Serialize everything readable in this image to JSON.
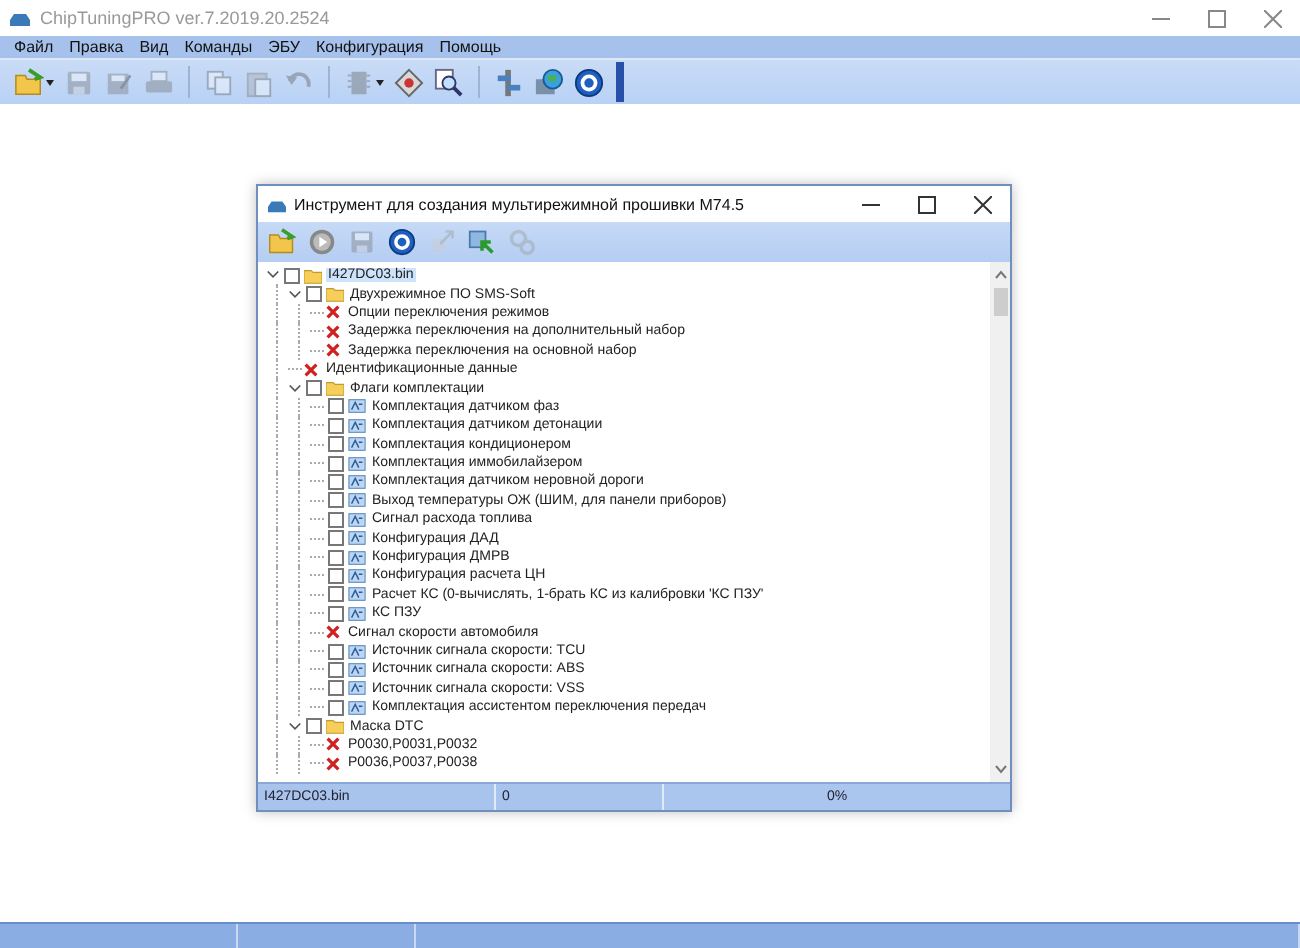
{
  "window": {
    "title": "ChipTuningPRO ver.7.2019.20.2524"
  },
  "menu": [
    "Файл",
    "Правка",
    "Вид",
    "Команды",
    "ЭБУ",
    "Конфигурация",
    "Помощь"
  ],
  "toolbar": [
    {
      "kind": "open",
      "disabled": false,
      "dropdown": true
    },
    {
      "kind": "save",
      "disabled": true,
      "dropdown": false
    },
    {
      "kind": "save-as",
      "disabled": true,
      "dropdown": false
    },
    {
      "kind": "print",
      "disabled": true,
      "dropdown": false
    },
    {
      "kind": "sep"
    },
    {
      "kind": "copy",
      "disabled": true,
      "dropdown": false
    },
    {
      "kind": "paste",
      "disabled": true,
      "dropdown": false
    },
    {
      "kind": "undo",
      "disabled": true,
      "dropdown": false
    },
    {
      "kind": "sep"
    },
    {
      "kind": "chip",
      "disabled": true,
      "dropdown": true
    },
    {
      "kind": "diamond",
      "disabled": false,
      "dropdown": false
    },
    {
      "kind": "zoom",
      "disabled": false,
      "dropdown": false
    },
    {
      "kind": "sep"
    },
    {
      "kind": "tools",
      "disabled": false,
      "dropdown": false
    },
    {
      "kind": "globe",
      "disabled": false,
      "dropdown": false
    },
    {
      "kind": "help",
      "disabled": false,
      "dropdown": false
    },
    {
      "kind": "overflow"
    }
  ],
  "dialog": {
    "title": "Инструмент для создания мультирежимной прошивки M74.5",
    "toolbar": [
      {
        "kind": "open",
        "disabled": false
      },
      {
        "kind": "play",
        "disabled": false
      },
      {
        "kind": "save",
        "disabled": true
      },
      {
        "kind": "help",
        "disabled": false
      },
      {
        "kind": "export",
        "disabled": true
      },
      {
        "kind": "import",
        "disabled": false
      },
      {
        "kind": "gears",
        "disabled": true
      }
    ],
    "tree": [
      {
        "kind": "folder",
        "label": "I427DC03.bin",
        "checked": false,
        "expanded": true,
        "selected": true,
        "children": [
          {
            "kind": "folder",
            "label": "Двухрежимное ПО SMS-Soft",
            "checked": false,
            "expanded": true,
            "selected": false,
            "children": [
              {
                "kind": "error",
                "label": "Опции переключения режимов",
                "selected": false
              },
              {
                "kind": "error",
                "label": "Задержка переключения на дополнительный набор",
                "selected": false
              },
              {
                "kind": "error",
                "label": "Задержка переключения на основной набор",
                "selected": false
              }
            ]
          },
          {
            "kind": "error",
            "label": "Идентификационные данные",
            "selected": false
          },
          {
            "kind": "folder",
            "label": "Флаги комплектации",
            "checked": false,
            "expanded": true,
            "selected": false,
            "children": [
              {
                "kind": "param",
                "label": "Комплектация датчиком фаз",
                "checked": false,
                "selected": false
              },
              {
                "kind": "param",
                "label": "Комплектация датчиком детонации",
                "checked": false,
                "selected": false
              },
              {
                "kind": "param",
                "label": "Комплектация кондиционером",
                "checked": false,
                "selected": false
              },
              {
                "kind": "param",
                "label": "Комплектация иммобилайзером",
                "checked": false,
                "selected": false
              },
              {
                "kind": "param",
                "label": "Комплектация датчиком неровной дороги",
                "checked": false,
                "selected": false
              },
              {
                "kind": "param",
                "label": "Выход температуры ОЖ (ШИМ, для панели приборов)",
                "checked": false,
                "selected": false
              },
              {
                "kind": "param",
                "label": "Сигнал расхода топлива",
                "checked": false,
                "selected": false
              },
              {
                "kind": "param",
                "label": "Конфигурация ДАД",
                "checked": false,
                "selected": false
              },
              {
                "kind": "param",
                "label": "Конфигурация ДМРВ",
                "checked": false,
                "selected": false
              },
              {
                "kind": "param",
                "label": "Конфигурация расчета ЦН",
                "checked": false,
                "selected": false
              },
              {
                "kind": "param",
                "label": "Расчет КС (0-вычислять, 1-брать КС из калибровки 'КС ПЗУ'",
                "checked": false,
                "selected": false
              },
              {
                "kind": "param",
                "label": "КС ПЗУ",
                "checked": false,
                "selected": false
              },
              {
                "kind": "error",
                "label": "Сигнал скорости автомобиля",
                "selected": false
              },
              {
                "kind": "param",
                "label": "Источник сигнала скорости: TCU",
                "checked": false,
                "selected": false
              },
              {
                "kind": "param",
                "label": "Источник сигнала скорости: ABS",
                "checked": false,
                "selected": false
              },
              {
                "kind": "param",
                "label": "Источник сигнала скорости: VSS",
                "checked": false,
                "selected": false
              },
              {
                "kind": "param",
                "label": "Комплектация ассистентом переключения передач",
                "checked": false,
                "selected": false
              }
            ]
          },
          {
            "kind": "folder",
            "label": "Маска DTC",
            "checked": false,
            "expanded": true,
            "selected": false,
            "children": [
              {
                "kind": "error",
                "label": "P0030,P0031,P0032",
                "selected": false
              },
              {
                "kind": "error",
                "label": "P0036,P0037,P0038",
                "selected": false
              }
            ]
          }
        ]
      }
    ],
    "status": {
      "file": "I427DC03.bin",
      "count": "0",
      "progress": {
        "level": 0,
        "reading": "0%"
      }
    }
  }
}
